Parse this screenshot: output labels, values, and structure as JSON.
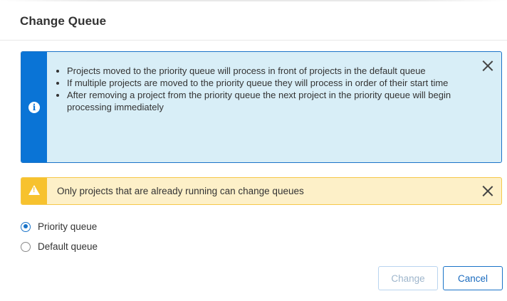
{
  "dialog": {
    "title": "Change Queue"
  },
  "info_alert": {
    "icon": "info-icon",
    "color": "#0a74d6",
    "items": [
      "Projects moved to the priority queue will process in front of projects in the default queue",
      "If multiple projects are moved to the priority queue they will process in order of their start time",
      "After removing a project from the priority queue the next project in the priority queue will begin processing immediately"
    ]
  },
  "warning_alert": {
    "icon": "warning-icon",
    "color": "#f7c22e",
    "text": "Only projects that are already running can change queues"
  },
  "queue_options": {
    "selected": "Priority queue",
    "options": [
      {
        "label": "Priority queue",
        "checked": true
      },
      {
        "label": "Default queue",
        "checked": false
      }
    ]
  },
  "buttons": {
    "change_label": "Change",
    "change_disabled": true,
    "cancel_label": "Cancel"
  }
}
